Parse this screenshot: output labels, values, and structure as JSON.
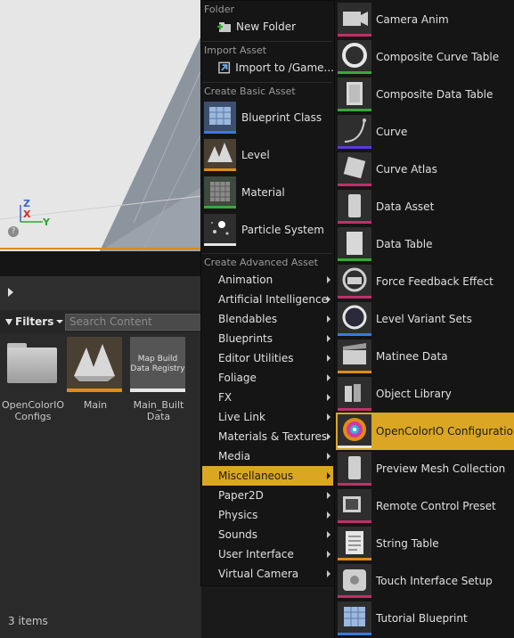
{
  "viewport": {
    "axis_z": "Z",
    "axis_x": "X",
    "axis_y": "Y",
    "help_glyph": "?"
  },
  "content_browser": {
    "filters_label": "Filters",
    "search_placeholder": "Search Content",
    "assets": [
      {
        "label": "OpenColorIO Configs",
        "icon": "folder-icon"
      },
      {
        "label": "Main",
        "icon": "level-icon"
      },
      {
        "label": "Main_Built Data",
        "tile_text": "Map Build Data Registry"
      }
    ],
    "items_count": "3 items"
  },
  "menu1": {
    "folder_header": "Folder",
    "new_folder": "New Folder",
    "import_header": "Import Asset",
    "import_to": "Import to /Game...",
    "basic_header": "Create Basic Asset",
    "basic_items": [
      {
        "label": "Blueprint Class",
        "icon": "blueprint-class-icon",
        "bar_color": "#3a7ae0"
      },
      {
        "label": "Level",
        "icon": "level-icon",
        "bar_color": "#e08c12"
      },
      {
        "label": "Material",
        "icon": "material-icon",
        "bar_color": "#3aa83a"
      },
      {
        "label": "Particle System",
        "icon": "particle-system-icon",
        "bar_color": "#e6e6e6"
      }
    ],
    "advanced_header": "Create Advanced Asset",
    "advanced_items": [
      "Animation",
      "Artificial Intelligence",
      "Blendables",
      "Blueprints",
      "Editor Utilities",
      "Foliage",
      "FX",
      "Live Link",
      "Materials & Textures",
      "Media",
      "Miscellaneous",
      "Paper2D",
      "Physics",
      "Sounds",
      "User Interface",
      "Virtual Camera"
    ],
    "selected_index": 10
  },
  "menu2": {
    "items": [
      {
        "label": "Camera Anim",
        "icon": "camera-anim-icon",
        "bar_color": "#c0306a"
      },
      {
        "label": "Composite Curve Table",
        "icon": "composite-curve-table-icon",
        "bar_color": "#3aa83a"
      },
      {
        "label": "Composite Data Table",
        "icon": "composite-data-table-icon",
        "bar_color": "#3aa83a"
      },
      {
        "label": "Curve",
        "icon": "curve-icon",
        "bar_color": "#5a3ae0"
      },
      {
        "label": "Curve Atlas",
        "icon": "curve-atlas-icon",
        "bar_color": "#c0306a"
      },
      {
        "label": "Data Asset",
        "icon": "data-asset-icon",
        "bar_color": "#c0306a"
      },
      {
        "label": "Data Table",
        "icon": "data-table-icon",
        "bar_color": "#3aa83a"
      },
      {
        "label": "Force Feedback Effect",
        "icon": "force-feedback-icon",
        "bar_color": "#c0306a"
      },
      {
        "label": "Level Variant Sets",
        "icon": "level-variant-sets-icon",
        "bar_color": "#3a7ae0"
      },
      {
        "label": "Matinee Data",
        "icon": "matinee-data-icon",
        "bar_color": "#e08c12"
      },
      {
        "label": "Object Library",
        "icon": "object-library-icon",
        "bar_color": "#c0306a"
      },
      {
        "label": "OpenColorIO Configuration",
        "icon": "opencolorio-icon",
        "bar_color": "#e6e6e6"
      },
      {
        "label": "Preview Mesh Collection",
        "icon": "preview-mesh-icon",
        "bar_color": "#c0306a"
      },
      {
        "label": "Remote Control Preset",
        "icon": "remote-control-icon",
        "bar_color": "#c0306a"
      },
      {
        "label": "String Table",
        "icon": "string-table-icon",
        "bar_color": "#e08c12"
      },
      {
        "label": "Touch Interface Setup",
        "icon": "touch-interface-icon",
        "bar_color": "#c0306a"
      },
      {
        "label": "Tutorial Blueprint",
        "icon": "tutorial-blueprint-icon",
        "bar_color": "#3a7ae0"
      }
    ],
    "selected_index": 11
  }
}
